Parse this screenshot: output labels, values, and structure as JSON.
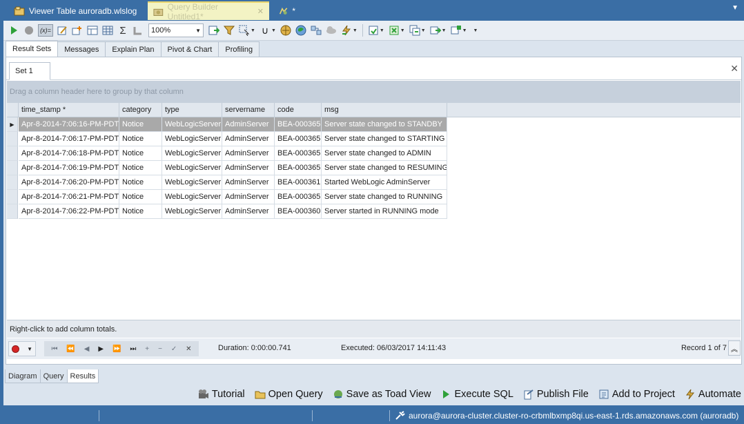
{
  "doc_tabs": [
    {
      "label": "Viewer Table auroradb.wlslog"
    },
    {
      "label": "Query Builder Untitled1*"
    },
    {
      "label": "*"
    }
  ],
  "toolbar": {
    "zoom": "100%"
  },
  "result_tabs": [
    "Result Sets",
    "Messages",
    "Explain Plan",
    "Pivot & Chart",
    "Profiling"
  ],
  "set_tab": "Set 1",
  "group_hint": "Drag a column header here to group by that column",
  "grid": {
    "columns": [
      "time_stamp *",
      "category",
      "type",
      "servername",
      "code",
      "msg"
    ],
    "rows": [
      [
        "Apr-8-2014-7:06:16-PM-PDT",
        "Notice",
        "WebLogicServer",
        "AdminServer",
        "BEA-000365",
        "Server state changed to STANDBY"
      ],
      [
        "Apr-8-2014-7:06:17-PM-PDT",
        "Notice",
        "WebLogicServer",
        "AdminServer",
        "BEA-000365",
        "Server state changed to STARTING"
      ],
      [
        "Apr-8-2014-7:06:18-PM-PDT",
        "Notice",
        "WebLogicServer",
        "AdminServer",
        "BEA-000365",
        "Server state changed to ADMIN"
      ],
      [
        "Apr-8-2014-7:06:19-PM-PDT",
        "Notice",
        "WebLogicServer",
        "AdminServer",
        "BEA-000365",
        "Server state changed to RESUMING"
      ],
      [
        "Apr-8-2014-7:06:20-PM-PDT",
        "Notice",
        "WebLogicServer",
        "AdminServer",
        "BEA-000361",
        "Started WebLogic AdminServer"
      ],
      [
        "Apr-8-2014-7:06:21-PM-PDT",
        "Notice",
        "WebLogicServer",
        "AdminServer",
        "BEA-000365",
        "Server state changed to RUNNING"
      ],
      [
        "Apr-8-2014-7:06:22-PM-PDT",
        "Notice",
        "WebLogicServer",
        "AdminServer",
        "BEA-000360",
        "Server started in RUNNING mode"
      ]
    ]
  },
  "totals_hint": "Right-click to add column totals.",
  "nav": {
    "duration": "Duration: 0:00:00.741",
    "executed": "Executed: 06/03/2017 14:11:43",
    "record": "Record 1 of 7"
  },
  "view_tabs": [
    "Diagram",
    "Query",
    "Results"
  ],
  "actions": [
    "Tutorial",
    "Open Query",
    "Save as Toad View",
    "Execute SQL",
    "Publish File",
    "Add to Project",
    "Automate"
  ],
  "status": {
    "connection": "aurora@aurora-cluster.cluster-ro-crbmlbxmp8qi.us-east-1.rds.amazonaws.com (auroradb)"
  },
  "colors": {
    "chrome": "#3a6ea5",
    "selected_row": "#a9a9a9",
    "active_doc_tab": "#f3f3c4"
  }
}
